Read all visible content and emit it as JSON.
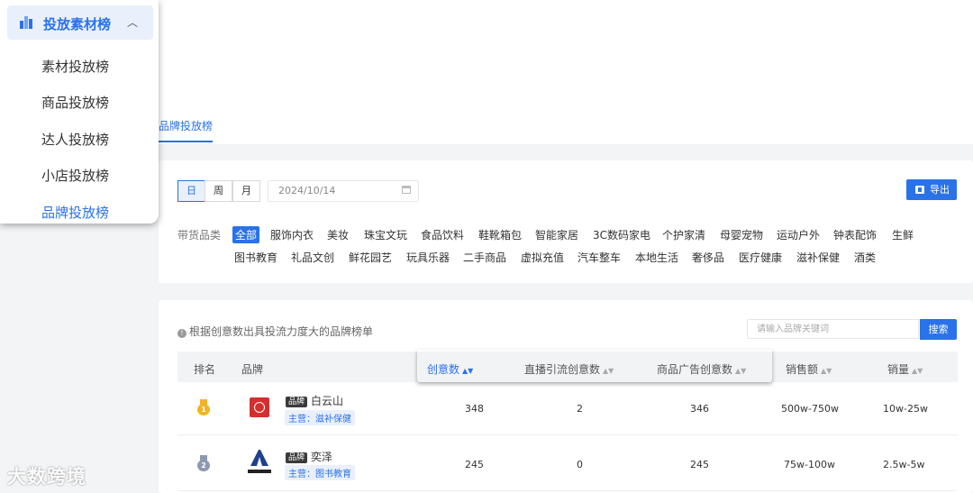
{
  "sidebar": {
    "title": "投放素材榜",
    "items": [
      {
        "label": "素材投放榜"
      },
      {
        "label": "商品投放榜"
      },
      {
        "label": "达人投放榜"
      },
      {
        "label": "小店投放榜"
      },
      {
        "label": "品牌投放榜"
      }
    ],
    "active_index": 4
  },
  "tabs": {
    "active_label": "品牌投放榜"
  },
  "filters": {
    "period_buttons": [
      "日",
      "周",
      "月"
    ],
    "active_period": "日",
    "date_value": "2024/10/14",
    "export_label": "导出",
    "category_label": "带货品类",
    "categories": [
      "全部",
      "服饰内衣",
      "美妆",
      "珠宝文玩",
      "食品饮料",
      "鞋靴箱包",
      "智能家居",
      "3C数码家电",
      "个护家清",
      "母婴宠物",
      "运动户外",
      "钟表配饰",
      "生鲜",
      "图书教育",
      "礼品文创",
      "鲜花园艺",
      "玩具乐器",
      "二手商品",
      "虚拟充值",
      "汽车整车",
      "本地生活",
      "奢侈品",
      "医疗健康",
      "滋补保健",
      "酒类"
    ],
    "active_category": "全部"
  },
  "table": {
    "note": "根据创意数出具投流力度大的品牌榜单",
    "search_placeholder": "请输入品牌关键词",
    "search_button": "搜索",
    "columns": [
      "排名",
      "品牌",
      "创意数",
      "直播引流创意数",
      "商品广告创意数",
      "销售额",
      "销量"
    ],
    "sorted_column": "创意数",
    "rows": [
      {
        "rank": 1,
        "tag": "品牌",
        "brand": "白云山",
        "main_category": "主营：滋补保健",
        "creatives": "348",
        "live_creatives": "2",
        "product_ad_creatives": "346",
        "sales": "500w-750w",
        "volume": "10w-25w"
      },
      {
        "rank": 2,
        "tag": "品牌",
        "brand": "奕泽",
        "main_category": "主营：图书教育",
        "creatives": "245",
        "live_creatives": "0",
        "product_ad_creatives": "245",
        "sales": "75w-100w",
        "volume": "2.5w-5w"
      }
    ]
  },
  "watermark": "大数跨境",
  "colors": {
    "accent": "#2a72e8",
    "gold": "#f0b429",
    "silver": "#8d99ae"
  }
}
